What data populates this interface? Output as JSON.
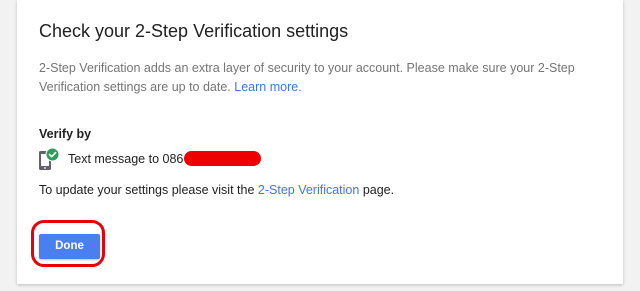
{
  "dialog": {
    "title": "Check your 2-Step Verification settings",
    "description": "2-Step Verification adds an extra layer of security to your account. Please make sure your 2-Step Verification settings are up to date.",
    "learn_more_link": "Learn more.",
    "verify_by_label": "Verify by",
    "method": {
      "text": "Text message to 086",
      "icon": "phone-check-icon",
      "redacted": true
    },
    "update": {
      "prefix": "To update your settings please visit the",
      "link": "2-Step Verification",
      "suffix": "page."
    },
    "done_button": "Done"
  },
  "colors": {
    "link": "#3b78e7",
    "button": "#4a7ff0",
    "annotation_red": "#e8000b",
    "check_green": "#2e9d5b"
  }
}
